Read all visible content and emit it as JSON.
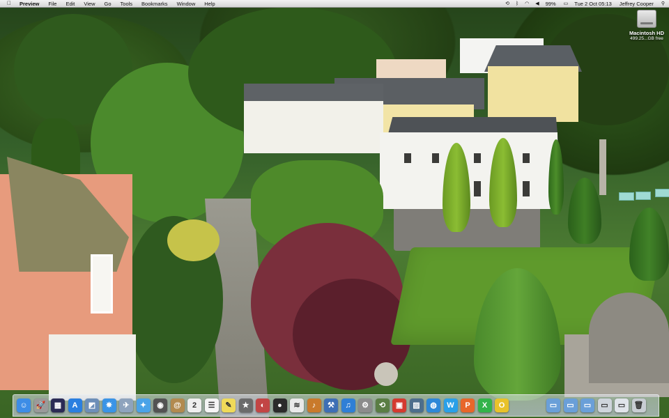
{
  "menubar": {
    "apple_icon": "apple-icon",
    "app_name": "Preview",
    "menus": [
      "File",
      "Edit",
      "View",
      "Go",
      "Tools",
      "Bookmarks",
      "Window",
      "Help"
    ],
    "status": {
      "battery_percent": "99%",
      "datetime": "Tue 2 Oct  05:13",
      "user": "Jeffrey Cooper"
    },
    "status_icons": [
      "time-machine-icon",
      "bluetooth-icon",
      "wifi-icon",
      "volume-icon",
      "battery-icon",
      "spotlight-icon"
    ]
  },
  "desktop": {
    "disk": {
      "name": "Macintosh HD",
      "free": "499.25...GB free"
    }
  },
  "dock": {
    "apps": [
      {
        "name": "finder-icon",
        "glyph": "☺",
        "color": "#3d8de6"
      },
      {
        "name": "launchpad-icon",
        "glyph": "🚀",
        "color": "#9a9a9a"
      },
      {
        "name": "mission-control-icon",
        "glyph": "▦",
        "color": "#2b2b55"
      },
      {
        "name": "app-store-icon",
        "glyph": "A",
        "color": "#2a7fe0"
      },
      {
        "name": "preview-icon",
        "glyph": "◩",
        "color": "#6d8fb8"
      },
      {
        "name": "safari-icon",
        "glyph": "✵",
        "color": "#3a94e6"
      },
      {
        "name": "mail-icon",
        "glyph": "✈",
        "color": "#8ea3bd"
      },
      {
        "name": "twitter-icon",
        "glyph": "✦",
        "color": "#4aa3e8"
      },
      {
        "name": "image-capture-icon",
        "glyph": "◉",
        "color": "#535353"
      },
      {
        "name": "contacts-icon",
        "glyph": "@",
        "color": "#b28a4f"
      },
      {
        "name": "calendar-icon",
        "glyph": "2",
        "color": "#efefef"
      },
      {
        "name": "reminders-icon",
        "glyph": "☰",
        "color": "#f5f5f5"
      },
      {
        "name": "notes-icon",
        "glyph": "✎",
        "color": "#f0da59"
      },
      {
        "name": "imovie-icon",
        "glyph": "★",
        "color": "#6b6b6b"
      },
      {
        "name": "photo-booth-icon",
        "glyph": "◐",
        "color": "#c24545"
      },
      {
        "name": "dvd-player-icon",
        "glyph": "●",
        "color": "#2b2b2b"
      },
      {
        "name": "network-icon",
        "glyph": "≋",
        "color": "#e9e9e9"
      },
      {
        "name": "guitar-icon",
        "glyph": "♪",
        "color": "#c97a2b"
      },
      {
        "name": "xcode-icon",
        "glyph": "⚒",
        "color": "#3e6fb5"
      },
      {
        "name": "itunes-icon",
        "glyph": "♫",
        "color": "#2f7fd6"
      },
      {
        "name": "system-preferences-icon",
        "glyph": "⚙",
        "color": "#8c8c8c"
      },
      {
        "name": "time-machine-icon",
        "glyph": "⟲",
        "color": "#5a7d44"
      },
      {
        "name": "flashcard-icon",
        "glyph": "▣",
        "color": "#d43a2f"
      },
      {
        "name": "iphoto-icon",
        "glyph": "▨",
        "color": "#4d6e8c"
      },
      {
        "name": "globe-icon",
        "glyph": "◍",
        "color": "#2d88d8"
      },
      {
        "name": "word-icon",
        "glyph": "W",
        "color": "#2aa0e8"
      },
      {
        "name": "powerpoint-icon",
        "glyph": "P",
        "color": "#e8662a"
      },
      {
        "name": "excel-icon",
        "glyph": "X",
        "color": "#33b34a"
      },
      {
        "name": "outlook-icon",
        "glyph": "O",
        "color": "#e8c22a"
      }
    ],
    "folders": [
      {
        "name": "applications-folder-icon",
        "glyph": "▭",
        "color": "#6a9fd8"
      },
      {
        "name": "documents-folder-icon",
        "glyph": "▭",
        "color": "#6a9fd8"
      },
      {
        "name": "downloads-folder-icon",
        "glyph": "▭",
        "color": "#6a9fd8"
      },
      {
        "name": "desktop-folder-icon",
        "glyph": "▭",
        "color": "#cfd5dc"
      },
      {
        "name": "screenshot-stack-icon",
        "glyph": "▭",
        "color": "#e0e4ea"
      },
      {
        "name": "trash-icon",
        "glyph": "🗑",
        "color": "#c8cdd3"
      }
    ]
  }
}
